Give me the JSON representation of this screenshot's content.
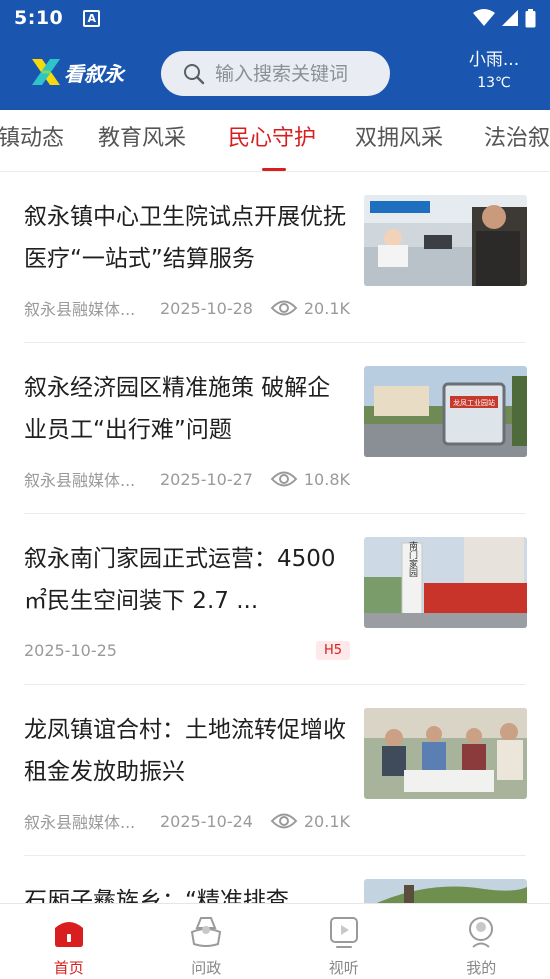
{
  "status_bar": {
    "time": "5:10",
    "notif_letter": "A"
  },
  "header": {
    "logo_text": "看叙永",
    "search": {
      "placeholder": "输入搜索关键词",
      "value": ""
    },
    "weather": {
      "desc": "小雨...",
      "temp": "13℃"
    }
  },
  "tabs": [
    {
      "label": "镇动态"
    },
    {
      "label": "教育风采"
    },
    {
      "label": "民心守护",
      "active": true
    },
    {
      "label": "双拥风采"
    },
    {
      "label": "法治叙"
    }
  ],
  "articles": [
    {
      "title": "叙永镇中心卫生院试点开展优抚医疗“一站式”结算服务",
      "source": "叙永县融媒体...",
      "date": "2025-10-28",
      "views": "20.1K"
    },
    {
      "title": "叙永经济园区精准施策 破解企业员工“出行难”问题",
      "source": "叙永县融媒体...",
      "date": "2025-10-27",
      "views": "10.8K"
    },
    {
      "title": "叙永南门家园正式运营：4500㎡民生空间装下 2.7 ...",
      "date": "2025-10-25",
      "badge": "H5"
    },
    {
      "title": "龙凤镇谊合村：土地流转促增收 租金发放助振兴",
      "source": "叙永县融媒体...",
      "date": "2025-10-24",
      "views": "20.1K"
    },
    {
      "title": "石厢子彝族乡：“精准排查"
    }
  ],
  "thumb_texts": {
    "bus_sign": "龙凤工业园站",
    "building_sign": "南门家园"
  },
  "bottom_nav": [
    {
      "label": "首页",
      "icon": "home-icon",
      "active": true
    },
    {
      "label": "问政",
      "icon": "inquiry-icon"
    },
    {
      "label": "视听",
      "icon": "media-icon"
    },
    {
      "label": "我的",
      "icon": "profile-icon"
    }
  ],
  "colors": {
    "brand_blue": "#1a55b0",
    "accent_red": "#d81e1e"
  }
}
